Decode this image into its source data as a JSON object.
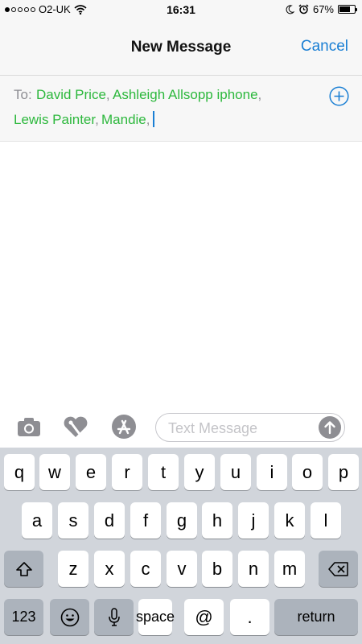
{
  "status_bar": {
    "carrier": "O2-UK",
    "time": "16:31",
    "battery_percent_label": "67%",
    "battery_level": 0.67,
    "icons": [
      "signal-dots-icon",
      "wifi-icon",
      "moon-icon",
      "alarm-icon",
      "battery-icon"
    ]
  },
  "nav": {
    "title": "New Message",
    "cancel_label": "Cancel"
  },
  "recipients": {
    "to_label": "To:",
    "list": [
      {
        "name": "David Price",
        "separator": ","
      },
      {
        "name": "Ashleigh Allsopp iphone",
        "separator": ","
      },
      {
        "name": "Lewis Painter",
        "separator": ","
      },
      {
        "name": "Mandie",
        "separator": ","
      }
    ]
  },
  "compose": {
    "placeholder": "Text Message",
    "icons": [
      "camera-icon",
      "digital-touch-icon",
      "app-store-icon",
      "send-arrow-icon"
    ]
  },
  "keyboard": {
    "row1": [
      "q",
      "w",
      "e",
      "r",
      "t",
      "y",
      "u",
      "i",
      "o",
      "p"
    ],
    "row2": [
      "a",
      "s",
      "d",
      "f",
      "g",
      "h",
      "j",
      "k",
      "l"
    ],
    "row3": [
      "z",
      "x",
      "c",
      "v",
      "b",
      "n",
      "m"
    ],
    "numbers_key": "123",
    "space_key": "space",
    "at_key": "@",
    "period_key": ".",
    "return_key": "return"
  },
  "colors": {
    "accent": "#1a7fd4",
    "recipient": "#2db83d",
    "keyboard_bg": "#d1d5db"
  }
}
